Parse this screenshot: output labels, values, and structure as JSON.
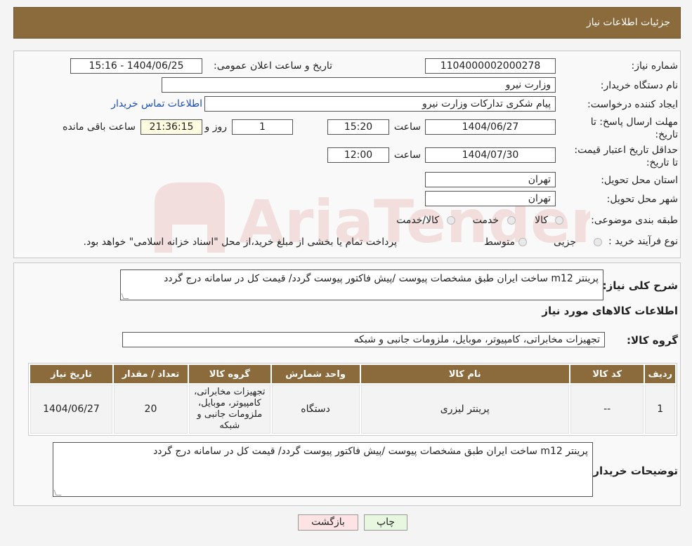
{
  "header": {
    "title": "جزئیات اطلاعات نیاز"
  },
  "form": {
    "need_number_label": "شماره نیاز:",
    "need_number": "1104000002000278",
    "announce_label": "تاریخ و ساعت اعلان عمومی:",
    "announce_value": "1404/06/25 - 15:16",
    "buyer_org_label": "نام دستگاه خریدار:",
    "buyer_org": "وزارت نیرو",
    "creator_label": "ایجاد کننده درخواست:",
    "creator": "پیام شکری تدارکات وزارت نیرو",
    "contact_link": "اطلاعات تماس خریدار",
    "deadline_label": "مهلت ارسال پاسخ: تا تاریخ:",
    "deadline_date": "1404/06/27",
    "time_word": "ساعت",
    "deadline_time": "15:20",
    "days_value": "1",
    "days_word": "روز و",
    "remaining_time": "21:36:15",
    "remaining_label": "ساعت باقی مانده",
    "validity_label": "حداقل تاریخ اعتبار قیمت: تا تاریخ:",
    "validity_date": "1404/07/30",
    "validity_time": "12:00",
    "province_label": "استان محل تحویل:",
    "province": "تهران",
    "city_label": "شهر محل تحویل:",
    "city": "تهران",
    "category_label": "طبقه بندی موضوعی:",
    "category_options": [
      "کالا",
      "خدمت",
      "کالا/خدمت"
    ],
    "process_label": "نوع فرآیند خرید :",
    "process_options": [
      "جزیی",
      "متوسط"
    ],
    "payment_note": "پرداخت تمام یا بخشی از مبلغ خرید،از محل \"اسناد خزانه اسلامی\" خواهد بود."
  },
  "details": {
    "summary_label": "شرح کلی نیاز:",
    "summary": "پرینتر m12 ساخت ایران طبق مشخصات پیوست /پیش فاکتور پیوست گردد/ قیمت کل در سامانه درج گردد",
    "goods_info_title": "اطلاعات کالاهای مورد نیاز",
    "goods_group_label": "گروه کالا:",
    "goods_group": "تجهیزات مخابراتی، کامپیوتر، موبایل، ملزومات جانبی و شبکه",
    "table": {
      "headers": [
        "ردیف",
        "کد کالا",
        "نام کالا",
        "واحد شمارش",
        "گروه کالا",
        "تعداد / مقدار",
        "تاریخ نیاز"
      ],
      "rows": [
        [
          "1",
          "--",
          "پرینتر لیزری",
          "دستگاه",
          "تجهیزات مخابراتی، کامپیوتر، موبایل، ملزومات جانبی و شبکه",
          "20",
          "1404/06/27"
        ]
      ]
    },
    "buyer_notes_label": "توضیحات خریدار:",
    "buyer_notes": "پرینتر m12 ساخت ایران طبق مشخصات پیوست /پیش فاکتور پیوست گردد/ قیمت کل در سامانه درج گردد"
  },
  "buttons": {
    "print": "چاپ",
    "back": "بازگشت"
  },
  "watermark": {
    "text": "AriaTender.neT"
  }
}
